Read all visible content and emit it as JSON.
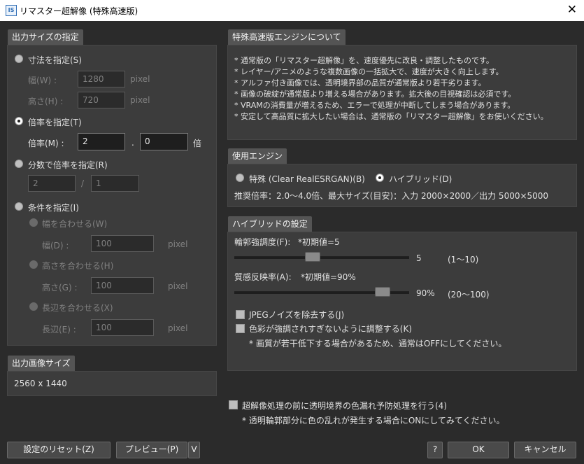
{
  "window": {
    "title": "リマスター超解像 (特殊高速版)",
    "icon": "IS"
  },
  "output_size_spec": {
    "tab": "出力サイズの指定",
    "by_size": {
      "label": "寸法を指定(S)",
      "width_label": "幅(W) :",
      "width_value": "1280",
      "height_label": "高さ(H) :",
      "height_value": "720",
      "unit": "pixel"
    },
    "by_scale": {
      "label": "倍率を指定(T)",
      "scale_label": "倍率(M) :",
      "int_value": "2",
      "dot": ".",
      "frac_value": "0",
      "unit": "倍"
    },
    "by_fraction": {
      "label": "分数で倍率を指定(R)",
      "numerator": "2",
      "slash": "/",
      "denominator": "1"
    },
    "by_condition": {
      "label": "条件を指定(I)",
      "fit_width": {
        "label": "幅を合わせる(W)",
        "field_label": "幅(D) :",
        "value": "100",
        "unit": "pixel"
      },
      "fit_height": {
        "label": "高さを合わせる(H)",
        "field_label": "高さ(G) :",
        "value": "100",
        "unit": "pixel"
      },
      "fit_long": {
        "label": "長辺を合わせる(X)",
        "field_label": "長辺(E) :",
        "value": "100",
        "unit": "pixel"
      }
    }
  },
  "output_image_size": {
    "tab": "出力画像サイズ",
    "value": "2560 x 1440"
  },
  "about_engine": {
    "tab": "特殊高速版エンジンについて",
    "lines": [
      "* 通常版の「リマスター超解像」を、速度優先に改良・調整したものです。",
      "* レイヤー/アニメのような複数画像の一括拡大で、速度が大きく向上します。",
      "* アルファ付き画像では、透明境界部の品質が通常版より若干劣ります。",
      "* 画像の破綻が通常版より増える場合があります。拡大後の目視確認は必須です。",
      "* VRAMの消費量が増えるため、エラーで処理が中断してしまう場合があります。",
      "* 安定して高品質に拡大したい場合は、通常版の「リマスター超解像」をお使いください。"
    ]
  },
  "engine": {
    "tab": "使用エンジン",
    "option_special": "特殊 (Clear RealESRGAN)(B)",
    "option_hybrid": "ハイブリッド(D)",
    "recommend": "推奨倍率：2.0～4.0倍、最大サイズ(目安)：入力 2000×2000／出力 5000×5000"
  },
  "hybrid": {
    "tab": "ハイブリッドの設定",
    "contour": {
      "label": "輪郭強調度(F):",
      "default": "*初期値=5",
      "value": "5",
      "range": "(1～10)",
      "fraction": 0.44
    },
    "texture": {
      "label": "質感反映率(A):",
      "default": "*初期値=90%",
      "value": "90%",
      "range": "(20～100)",
      "fraction": 0.875
    },
    "jpeg_noise": "JPEGノイズを除去する(J)",
    "color_adjust": "色彩が強調されすぎないように調整する(K)",
    "note": "* 画質が若干低下する場合があるため、通常はOFFにしてください。"
  },
  "pre_process": {
    "label": "超解像処理の前に透明境界の色漏れ予防処理を行う(4)",
    "note": "* 透明輪郭部分に色の乱れが発生する場合にONにしてみてください。"
  },
  "buttons": {
    "reset": "設定のリセット(Z)",
    "preview": "プレビュー(P)",
    "preview_arrow": "V",
    "help": "?",
    "ok": "OK",
    "cancel": "キャンセル"
  },
  "colors": {
    "background": "#2b2b2b",
    "panel": "#3c3c3c",
    "tab": "#545454",
    "text": "#e0e0e0",
    "disabled": "#808080"
  }
}
